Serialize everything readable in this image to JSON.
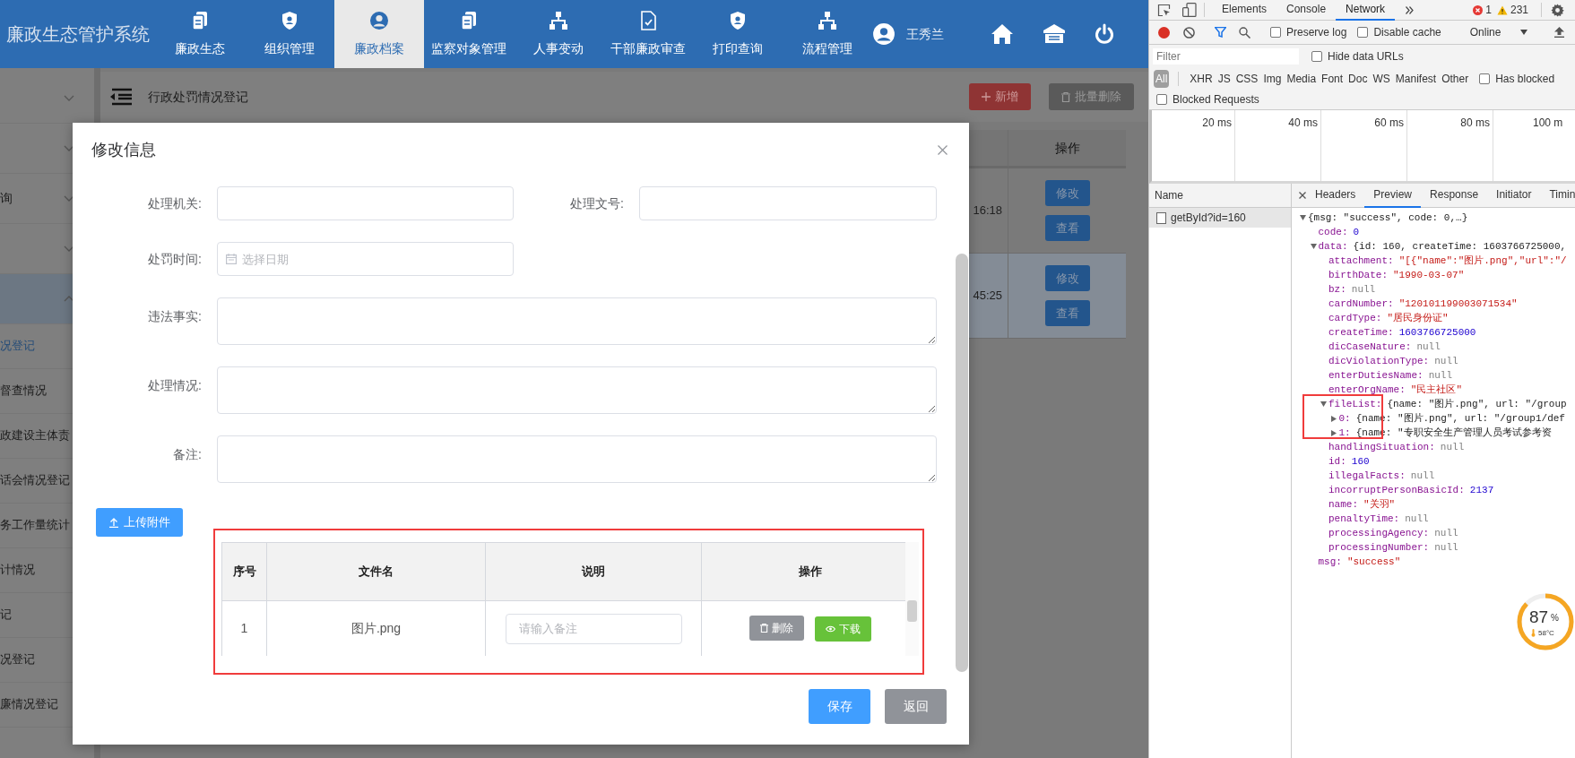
{
  "app": {
    "title": "廉政生态管护系统",
    "nav": [
      {
        "label": "廉政生态",
        "kind": "documents",
        "selected": false
      },
      {
        "label": "组织管理",
        "kind": "shield",
        "selected": false
      },
      {
        "label": "廉政档案",
        "kind": "person",
        "selected": true
      },
      {
        "label": "监察对象管理",
        "kind": "documents",
        "selected": false
      },
      {
        "label": "人事变动",
        "kind": "hierarchy",
        "selected": false
      },
      {
        "label": "干部廉政审查",
        "kind": "document-check",
        "selected": false
      },
      {
        "label": "打印查询",
        "kind": "shield",
        "selected": false
      },
      {
        "label": "流程管理",
        "kind": "hierarchy",
        "selected": false
      }
    ],
    "user": {
      "name": "王秀兰"
    },
    "sidebar": {
      "groups": [
        {
          "expanded": false
        },
        {
          "expanded": false
        },
        {
          "label": "询",
          "expanded": false
        },
        {
          "expanded": false
        },
        {
          "expanded": true,
          "children": [
            {
              "label": "况登记",
              "selected": true
            },
            {
              "label": "督查情况",
              "selected": false
            },
            {
              "label": "政建设主体责",
              "selected": false
            },
            {
              "label": "话会情况登记",
              "selected": false
            },
            {
              "label": "务工作量统计",
              "selected": false
            },
            {
              "label": "计情况",
              "selected": false
            },
            {
              "label": "记",
              "selected": false
            },
            {
              "label": "况登记",
              "selected": false
            },
            {
              "label": "廉情况登记",
              "selected": false
            }
          ]
        }
      ]
    },
    "page": {
      "title": "行政处罚情况登记",
      "buttons": [
        {
          "label": "新增",
          "kind": "add"
        },
        {
          "label": "批量删除",
          "kind": "delete"
        }
      ],
      "table": {
        "action_header": "操作",
        "rows": [
          {
            "time": "16:18",
            "hovered": false,
            "actions": [
              {
                "label": "修改"
              },
              {
                "label": "查看"
              }
            ]
          },
          {
            "time": "45:25",
            "hovered": true,
            "actions": [
              {
                "label": "修改"
              },
              {
                "label": "查看"
              }
            ]
          }
        ]
      }
    }
  },
  "modal": {
    "title": "修改信息",
    "fields": [
      {
        "label": "处理机关:",
        "kind": "input"
      },
      {
        "label": "处理文号:",
        "kind": "input"
      },
      {
        "label": "处罚时间:",
        "kind": "date",
        "placeholder": "选择日期"
      },
      {
        "label": "违法事实:",
        "kind": "textarea"
      },
      {
        "label": "处理情况:",
        "kind": "textarea"
      },
      {
        "label": "备注:",
        "kind": "textarea"
      }
    ],
    "upload_button": "上传附件",
    "attachments": {
      "columns": [
        "序号",
        "文件名",
        "说明",
        "操作"
      ],
      "rows": [
        {
          "index": "1",
          "file": "图片.png",
          "note_placeholder": "请输入备注",
          "actions": [
            {
              "label": "删除",
              "kind": "delete"
            },
            {
              "label": "下载",
              "kind": "download"
            }
          ]
        }
      ]
    },
    "buttons": [
      {
        "label": "保存",
        "kind": "primary"
      },
      {
        "label": "返回",
        "kind": "secondary"
      }
    ]
  },
  "devtools": {
    "tabs": [
      {
        "label": "Elements",
        "selected": false
      },
      {
        "label": "Console",
        "selected": false
      },
      {
        "label": "Network",
        "selected": true
      }
    ],
    "errors": "1",
    "warnings": "231",
    "checkboxes": [
      {
        "label": "Preserve log",
        "checked": false
      },
      {
        "label": "Disable cache",
        "checked": false
      }
    ],
    "throttle": "Online",
    "filter": {
      "placeholder": "Filter"
    },
    "hide_data_urls": {
      "label": "Hide data URLs",
      "checked": false
    },
    "types": [
      {
        "label": "All",
        "selected": true
      },
      {
        "label": "XHR",
        "selected": false
      },
      {
        "label": "JS",
        "selected": false
      },
      {
        "label": "CSS",
        "selected": false
      },
      {
        "label": "Img",
        "selected": false
      },
      {
        "label": "Media",
        "selected": false
      },
      {
        "label": "Font",
        "selected": false
      },
      {
        "label": "Doc",
        "selected": false
      },
      {
        "label": "WS",
        "selected": false
      },
      {
        "label": "Manifest",
        "selected": false
      },
      {
        "label": "Other",
        "selected": false
      }
    ],
    "has_blocked": {
      "label": "Has blocked",
      "checked": false
    },
    "blocked_requests": {
      "label": "Blocked Requests",
      "checked": false
    },
    "timeline": {
      "ticks": [
        "20 ms",
        "40 ms",
        "60 ms",
        "80 ms",
        "100 m"
      ]
    },
    "requests": {
      "header": "Name",
      "rows": [
        {
          "name": "getById?id=160",
          "selected": true
        }
      ]
    },
    "detail_tabs": [
      {
        "label": "Headers",
        "selected": false
      },
      {
        "label": "Preview",
        "selected": true
      },
      {
        "label": "Response",
        "selected": false
      },
      {
        "label": "Initiator",
        "selected": false
      },
      {
        "label": "Timin",
        "selected": false
      }
    ],
    "tree": [
      {
        "value": "{msg: \"success\", code: 0,…}",
        "kind": "object",
        "expanded": true,
        "children": [
          {
            "key": "code:",
            "value": "0",
            "kind": "number"
          },
          {
            "key": "data:",
            "value": "{id: 160, createTime: 1603766725000,",
            "kind": "object",
            "expanded": true,
            "children": [
              {
                "key": "attachment:",
                "value": "\"[{\"name\":\"图片.png\",\"url\":\"/",
                "kind": "string"
              },
              {
                "key": "birthDate:",
                "value": "\"1990-03-07\"",
                "kind": "string"
              },
              {
                "key": "bz:",
                "value": "null",
                "kind": "null"
              },
              {
                "key": "cardNumber:",
                "value": "\"120101199003071534\"",
                "kind": "string"
              },
              {
                "key": "cardType:",
                "value": "\"居民身份证\"",
                "kind": "string"
              },
              {
                "key": "createTime:",
                "value": "1603766725000",
                "kind": "number"
              },
              {
                "key": "dicCaseNature:",
                "value": "null",
                "kind": "null"
              },
              {
                "key": "dicViolationType:",
                "value": "null",
                "kind": "null"
              },
              {
                "key": "enterDutiesName:",
                "value": "null",
                "kind": "null"
              },
              {
                "key": "enterOrgName:",
                "value": "\"民主社区\"",
                "kind": "string"
              },
              {
                "key": "fileList:",
                "value": "{name: \"图片.png\", url: \"/group",
                "kind": "object",
                "expanded": true,
                "children": [
                  {
                    "key": "0:",
                    "value": "{name: \"图片.png\", url: \"/group1/def",
                    "kind": "object",
                    "expanded": false
                  },
                  {
                    "key": "1:",
                    "value": "{name: \"专职安全生产管理人员考试参考资",
                    "kind": "object",
                    "expanded": false
                  }
                ]
              },
              {
                "key": "handlingSituation:",
                "value": "null",
                "kind": "null"
              },
              {
                "key": "id:",
                "value": "160",
                "kind": "number"
              },
              {
                "key": "illegalFacts:",
                "value": "null",
                "kind": "null"
              },
              {
                "key": "incorruptPersonBasicId:",
                "value": "2137",
                "kind": "number"
              },
              {
                "key": "name:",
                "value": "\"关羽\"",
                "kind": "string"
              },
              {
                "key": "penaltyTime:",
                "value": "null",
                "kind": "null"
              },
              {
                "key": "processingAgency:",
                "value": "null",
                "kind": "null"
              },
              {
                "key": "processingNumber:",
                "value": "null",
                "kind": "null"
              }
            ]
          },
          {
            "key": "msg:",
            "value": "\"success\"",
            "kind": "string"
          }
        ]
      }
    ]
  },
  "gauge": {
    "value": "87",
    "unit": "%",
    "temperature": "58°C",
    "level": 0.87
  }
}
